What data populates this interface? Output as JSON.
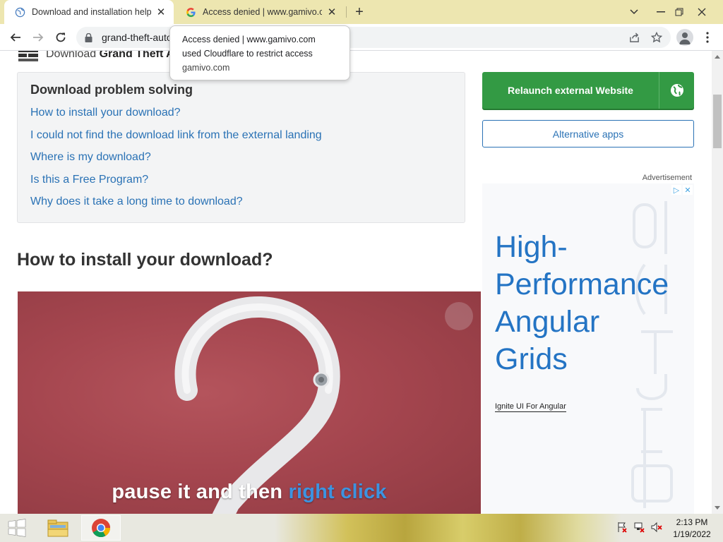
{
  "tabs": [
    {
      "title": "Download and installation help",
      "icon": "globe-icon",
      "active": true
    },
    {
      "title": "Access denied | www.gamivo.com",
      "icon": "google-icon",
      "active": false
    }
  ],
  "window_controls": {
    "dropdown": "chevron-down-icon",
    "minimize": "minimize-icon",
    "restore": "restore-icon",
    "close": "close-icon"
  },
  "toolbar": {
    "url": "grand-theft-auto-",
    "icons": [
      "back-icon",
      "forward-icon",
      "reload-icon",
      "lock-icon",
      "share-icon",
      "star-icon",
      "profile-icon",
      "menu-icon"
    ]
  },
  "tooltip": {
    "line1": "Access denied | www.gamivo.com",
    "line2": "used Cloudflare to restrict access",
    "domain": "gamivo.com"
  },
  "page": {
    "breadcrumb_prefix": "Download ",
    "breadcrumb_bold": "Grand Theft A",
    "problem_box": {
      "title": "Download problem solving",
      "links": [
        "How to install your download?",
        "I could not find the download link from the external landing",
        "Where is my download?",
        "Is this a Free Program?",
        "Why does it take a long time to download?"
      ]
    },
    "section_title": "How to install your download?",
    "video": {
      "caption_plain": "pause it and then ",
      "caption_highlight": "right click"
    },
    "sidebar": {
      "relaunch_label": "Relaunch external Website",
      "alt_apps_label": "Alternative apps"
    },
    "ad": {
      "label": "Advertisement",
      "headline": [
        "High-",
        "Performance",
        "Angular",
        "Grids"
      ],
      "cta": "Ignite UI For Angular",
      "color": "#2474c4"
    }
  },
  "taskbar": {
    "time": "2:13 PM",
    "date": "1/19/2022",
    "apps": [
      "file-explorer-icon",
      "chrome-icon"
    ],
    "tray": [
      "action-center-icon",
      "network-icon",
      "volume-muted-icon"
    ]
  },
  "colors": {
    "tabstrip": "#ede6b0",
    "link": "#2a72b5",
    "relaunch": "#339a44"
  }
}
